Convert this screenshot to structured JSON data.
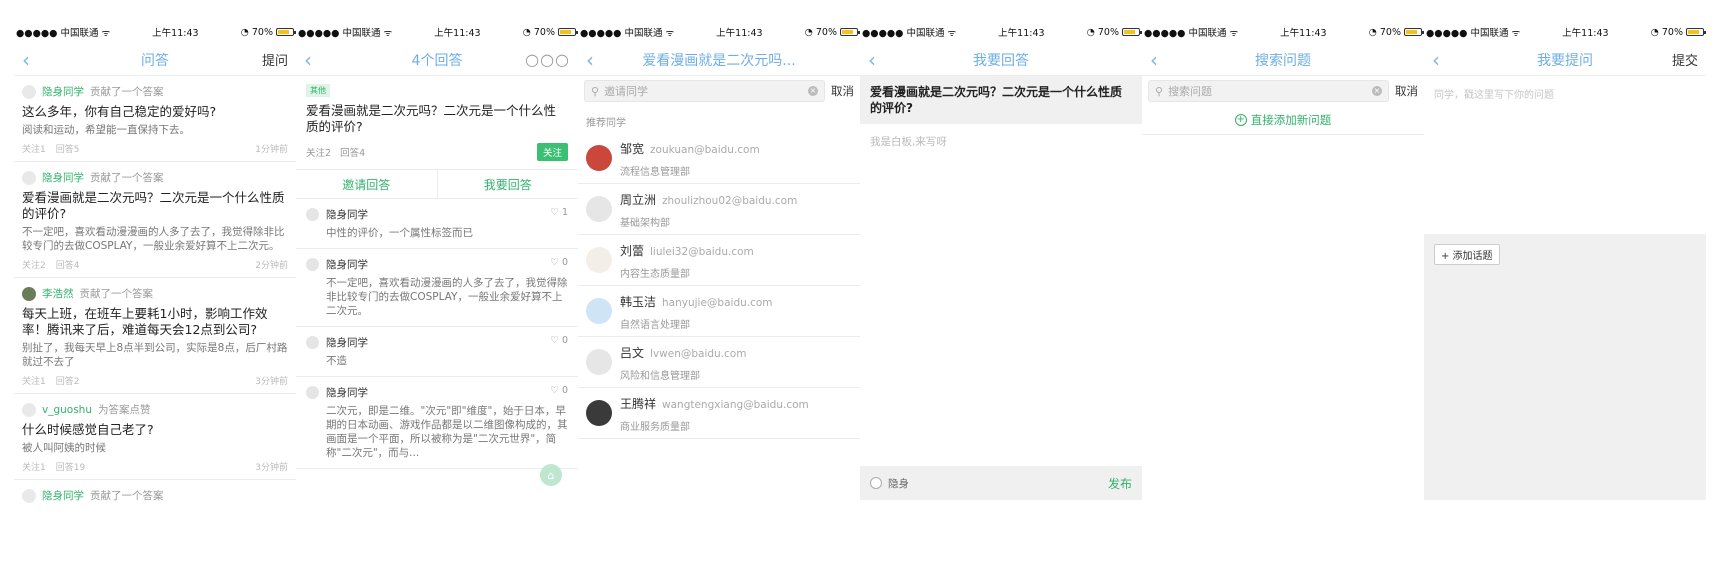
{
  "status": {
    "carrier": "●●●●● 中国联通",
    "wifi": "wifi",
    "time": "上午11:43",
    "battery": "70%"
  },
  "screens": [
    {
      "nav": {
        "title": "问答",
        "action": "提问"
      },
      "feed": [
        {
          "name": "隐身同学",
          "verb": "贡献了一个答案",
          "title": "这么多年，你有自己稳定的爱好吗?",
          "body": "阅读和运动，希望能一直保持下去。",
          "meta_follow": "关注1",
          "meta_answer": "回答5",
          "time": "1分钟前"
        },
        {
          "name": "隐身同学",
          "verb": "贡献了一个答案",
          "title": "爱看漫画就是二次元吗？二次元是一个什么性质的评价?",
          "body": "不一定吧，喜欢看动漫漫画的人多了去了，我觉得除非比较专门的去做COSPLAY，一般业余爱好算不上二次元。",
          "meta_follow": "关注2",
          "meta_answer": "回答4",
          "time": "2分钟前"
        },
        {
          "name": "李浩然",
          "verb": "贡献了一个答案",
          "title": "每天上班，在班车上要耗1小时，影响工作效率！腾讯来了后，难道每天会12点到公司?",
          "body": "别扯了，我每天早上8点半到公司，实际是8点，后厂村路就过不去了",
          "meta_follow": "关注1",
          "meta_answer": "回答2",
          "time": "3分钟前"
        },
        {
          "name": "v_guoshu",
          "verb": "为答案点赞",
          "title": "什么时候感觉自己老了?",
          "body": "被人叫阿姨的时候",
          "meta_follow": "关注1",
          "meta_answer": "回答19",
          "time": "3分钟前"
        },
        {
          "name": "隐身同学",
          "verb": "贡献了一个答案"
        }
      ]
    },
    {
      "nav": {
        "title": "4个回答",
        "action": "○○○"
      },
      "tag": "其他",
      "question": "爱看漫画就是二次元吗？二次元是一个什么性质的评价?",
      "follow_count": "关注2",
      "answer_count": "回答4",
      "follow_button": "关注",
      "invite": "邀请回答",
      "my_answer": "我要回答",
      "answers": [
        {
          "author": "隐身同学",
          "likes": "1",
          "text": "中性的评价，一个属性标签而已"
        },
        {
          "author": "隐身同学",
          "likes": "0",
          "text": "不一定吧，喜欢看动漫漫画的人多了去了，我觉得除非比较专门的去做COSPLAY，一般业余爱好算不上二次元。"
        },
        {
          "author": "隐身同学",
          "likes": "0",
          "text": "不造"
        },
        {
          "author": "隐身同学",
          "likes": "0",
          "text": "二次元，即是二维。\"次元\"即\"维度\"，始于日本，早期的日本动画、游戏作品都是以二维图像构成的，其画面是一个平面，所以被称为是\"二次元世界\"，简称\"二次元\"，而与..."
        }
      ]
    },
    {
      "nav": {
        "title": "爱看漫画就是二次元吗..."
      },
      "search_placeholder": "邀请同学",
      "cancel": "取消",
      "section": "推荐同学",
      "people": [
        {
          "name": "邹宽",
          "email": "zoukuan@baidu.com",
          "dept": "流程信息管理部",
          "color": "#c9473b"
        },
        {
          "name": "周立洲",
          "email": "zhoulizhou02@baidu.com",
          "dept": "基础架构部",
          "color": "#e6e6e6"
        },
        {
          "name": "刘蕾",
          "email": "liulei32@baidu.com",
          "dept": "内容生态质量部",
          "color": "#f3eee8"
        },
        {
          "name": "韩玉洁",
          "email": "hanyujie@baidu.com",
          "dept": "自然语言处理部",
          "color": "#cfe5f5"
        },
        {
          "name": "吕文",
          "email": "lvwen@baidu.com",
          "dept": "风险和信息管理部",
          "color": "#e6e6e6"
        },
        {
          "name": "王腾祥",
          "email": "wangtengxiang@baidu.com",
          "dept": "商业服务质量部",
          "color": "#3a3a3a"
        }
      ]
    },
    {
      "nav": {
        "title": "我要回答"
      },
      "question": "爱看漫画就是二次元吗？二次元是一个什么性质的评价?",
      "placeholder": "我是白板,来写呀",
      "anonymous": "隐身",
      "publish": "发布"
    },
    {
      "nav": {
        "title": "搜索问题"
      },
      "search_placeholder": "搜索问题",
      "cancel": "取消",
      "add_new": "直接添加新问题"
    },
    {
      "nav": {
        "title": "我要提问",
        "action": "提交"
      },
      "placeholder": "同学，戳这里写下你的问题",
      "add_topic": "+ 添加话题"
    }
  ],
  "colors": {
    "accent_green": "#32b16c",
    "nav_blue": "#6eaee6",
    "battery_yellow": "#f4c21e"
  },
  "icons": [
    "back-chevron-icon",
    "search-icon",
    "clear-icon",
    "like-icon",
    "plus-circle-icon",
    "home-fab-icon"
  ]
}
